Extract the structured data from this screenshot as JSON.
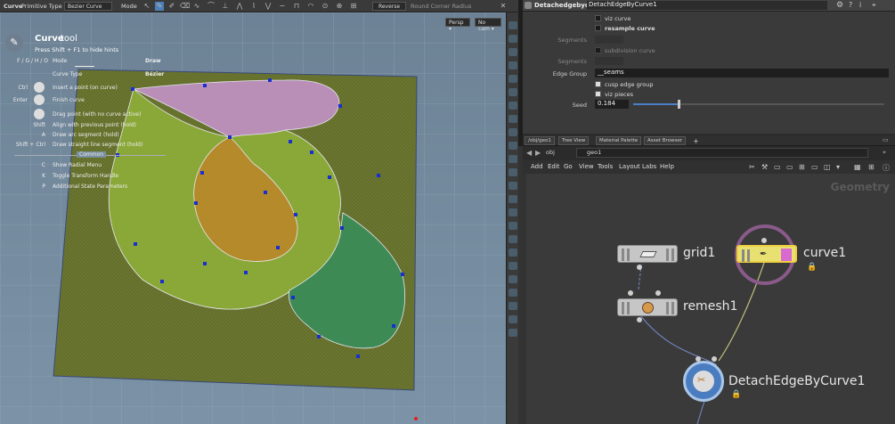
{
  "toolbar": {
    "tool_name": "Curve",
    "primitive_label": "Primitive Type",
    "primitive_value": "Bezier Curve",
    "mode_label": "Mode",
    "reverse": "Reverse",
    "round_corner": "Round Corner Radius"
  },
  "viewport": {
    "persp": "Persp ▾",
    "cam": "No cam ▾"
  },
  "hud": {
    "title": "Curve",
    "title2": "tool",
    "hint": "Press Shift + F1 to hide hints",
    "keys_mode": "F / G / H / O",
    "mode": "Mode",
    "draw": "Draw",
    "curve_type": "Curve Type",
    "bezier": "Bézier",
    "rows": [
      {
        "key": "Ctrl",
        "label": "Insert a point (on curve)"
      },
      {
        "key": "Enter",
        "label": "Finish curve"
      },
      {
        "key": "",
        "label": "Drag point (with no curve active)"
      },
      {
        "key": "Shift",
        "label": "Align with previous point (hold)"
      },
      {
        "key": "A",
        "label": "Draw arc segment (hold)"
      },
      {
        "key": "Shift + Ctrl",
        "label": "Draw straight line segment (hold)"
      }
    ],
    "common": "Common",
    "common_rows": [
      {
        "key": "C",
        "label": "Show Radial Menu"
      },
      {
        "key": "K",
        "label": "Toggle Transform Handle"
      },
      {
        "key": "P",
        "label": "Additional State Parameters"
      }
    ]
  },
  "params": {
    "type": "Detachedgebycurve",
    "name": "DetachEdgeByCurve1",
    "viz_curve": "viz curve",
    "resample": "resample curve",
    "segments1": "Segments",
    "subdiv": "subdivision curve",
    "segments2": "Segments",
    "edge_group_label": "Edge Group",
    "edge_group_value": "__seams",
    "cusp": "cusp edge group",
    "viz_pieces": "viz pieces",
    "seed_label": "Seed",
    "seed_value": "0.184",
    "seed_fraction": 0.18
  },
  "tabs": [
    "/obj/geo1",
    "Tree View",
    "Material Palette",
    "Asset Browser",
    "+"
  ],
  "path": {
    "obj": "obj",
    "geo": "geo1"
  },
  "menus": [
    "Add",
    "Edit",
    "Go",
    "View",
    "Tools",
    "Layout",
    "Labs",
    "Help"
  ],
  "network": {
    "context": "Geometry",
    "nodes": {
      "grid": "grid1",
      "curve": "curve1",
      "remesh": "remesh1",
      "detach": "DetachEdgeByCurve1"
    }
  }
}
